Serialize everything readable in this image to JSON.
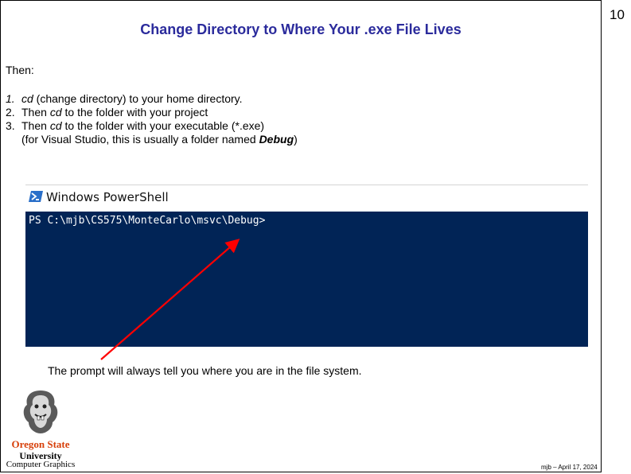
{
  "slide": {
    "number": "10",
    "title": "Change Directory to Where Your .exe File Lives",
    "intro": "Then:",
    "steps": [
      {
        "num": "1.",
        "pre": "",
        "em": "cd",
        "post": " (change directory) to your home directory."
      },
      {
        "num": "2.",
        "pre": "Then ",
        "em": "cd",
        "post": " to the folder with your project"
      },
      {
        "num": "3.",
        "pre": "Then ",
        "em": "cd",
        "post": " to the folder with your executable (*.exe)"
      }
    ],
    "step3_line2_pre": "(for Visual Studio, this is usually a folder named ",
    "step3_line2_em": "Debug",
    "step3_line2_post": ")",
    "caption": "The prompt will always tell you where you are in the file system.",
    "footer": "mjb – April 17, 2024"
  },
  "powershell": {
    "window_title": "Windows PowerShell",
    "prompt": "PS C:\\mjb\\CS575\\MonteCarlo\\msvc\\Debug>",
    "icon": "powershell-icon",
    "colors": {
      "console_bg": "#012456",
      "text": "#ffffff"
    }
  },
  "logo": {
    "line1": "Oregon State",
    "line2": "University",
    "line3": "Computer Graphics",
    "icon": "beaver-logo-icon",
    "brand_color": "#d73f09"
  },
  "colors": {
    "title": "#2b2b9c",
    "arrow": "#ff0000"
  }
}
